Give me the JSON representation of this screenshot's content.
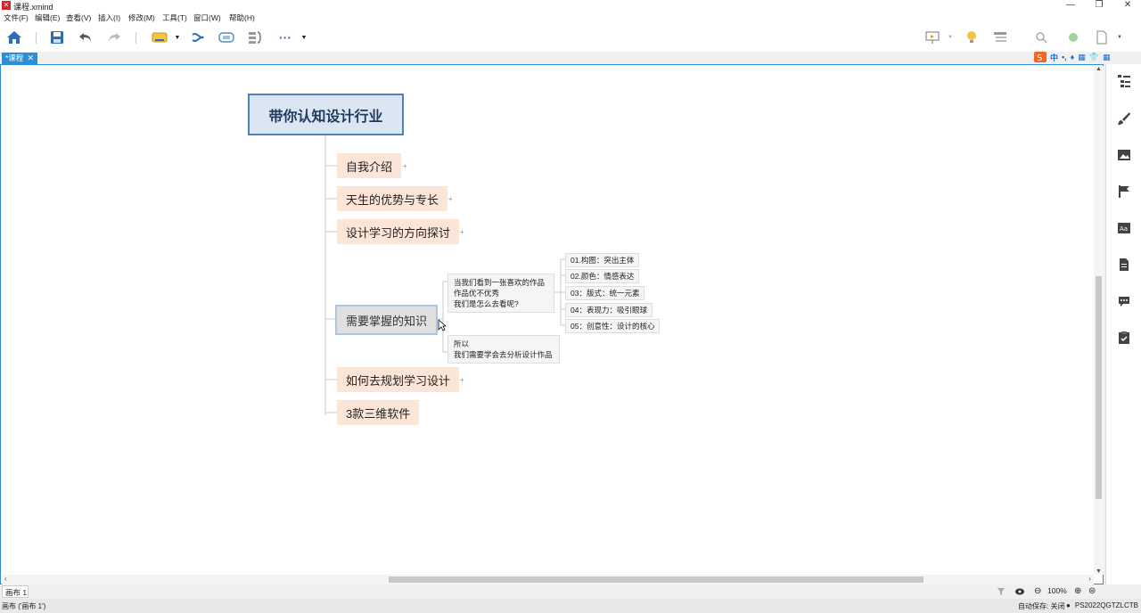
{
  "window": {
    "title": "课程.xmind"
  },
  "menu": [
    "文件(F)",
    "编辑(E)",
    "查看(V)",
    "插入(I)",
    "修改(M)",
    "工具(T)",
    "窗口(W)",
    "帮助(H)"
  ],
  "tab": {
    "label": "*课程",
    "close": "✕"
  },
  "ime": [
    "中",
    "•,",
    "♦",
    "▦",
    "👕",
    "▦"
  ],
  "mindmap": {
    "central": "带你认知设计行业",
    "topics": [
      {
        "label": "自我介绍"
      },
      {
        "label": "天生的优势与专长"
      },
      {
        "label": "设计学习的方向探讨"
      },
      {
        "label": "需要掌握的知识"
      },
      {
        "label": "如何去规划学习设计"
      },
      {
        "label": "3款三维软件"
      }
    ],
    "note1": [
      "当我们看到一张喜欢的作品",
      "作品优不优秀",
      "我们是怎么去看呢?"
    ],
    "note2": [
      "所以",
      "我们需要学会去分析设计作品"
    ],
    "points": [
      "01.构图：突出主体",
      "02.颜色：情感表达",
      "03：版式：统一元素",
      "04：表现力：吸引眼球",
      "05：创意性：设计的核心"
    ]
  },
  "status": {
    "sheet": "画布 1",
    "zoom": "100%",
    "bottom_left": "画布 ('画布 1')",
    "autosave": "自动保存: 关闭",
    "license": "PS2022QGTZLCTB"
  },
  "colors": {
    "accent": "#2a8fd6",
    "topic_fill": "#fbe5d6",
    "central_fill": "#dce6f2",
    "central_border": "#4f81bd"
  }
}
